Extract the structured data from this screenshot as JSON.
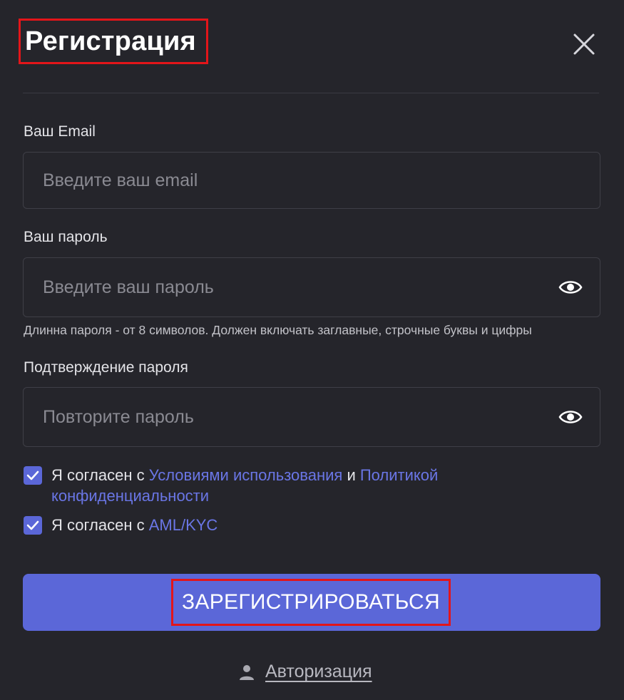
{
  "dialog": {
    "title": "Регистрация",
    "close_icon": "close-icon"
  },
  "email": {
    "label": "Ваш Email",
    "placeholder": "Введите ваш email",
    "value": ""
  },
  "password": {
    "label": "Ваш пароль",
    "placeholder": "Введите ваш пароль",
    "value": "",
    "toggle_icon": "eye-icon",
    "hint": "Длинна пароля - от 8 символов. Должен включать заглавные, строчные буквы и цифры"
  },
  "confirm": {
    "label": "Подтверждение пароля",
    "placeholder": "Повторите пароль",
    "value": "",
    "toggle_icon": "eye-icon"
  },
  "agreements": {
    "terms": {
      "checked": true,
      "prefix": "Я согласен с ",
      "terms_link": "Условиями использования",
      "conjunction": " и ",
      "privacy_link_line1": "Политикой",
      "privacy_link_line2": "конфиденциальности"
    },
    "aml": {
      "checked": true,
      "prefix": "Я согласен с ",
      "link": "AML/KYC"
    }
  },
  "submit": {
    "label": "ЗАРЕГИСТРИРОВАТЬСЯ"
  },
  "footer": {
    "auth_icon": "user-icon",
    "auth_label": "Авторизация"
  },
  "colors": {
    "background": "#25252b",
    "accent": "#5b67d8",
    "link": "#6a76e6",
    "highlight_box": "#e3151a"
  }
}
